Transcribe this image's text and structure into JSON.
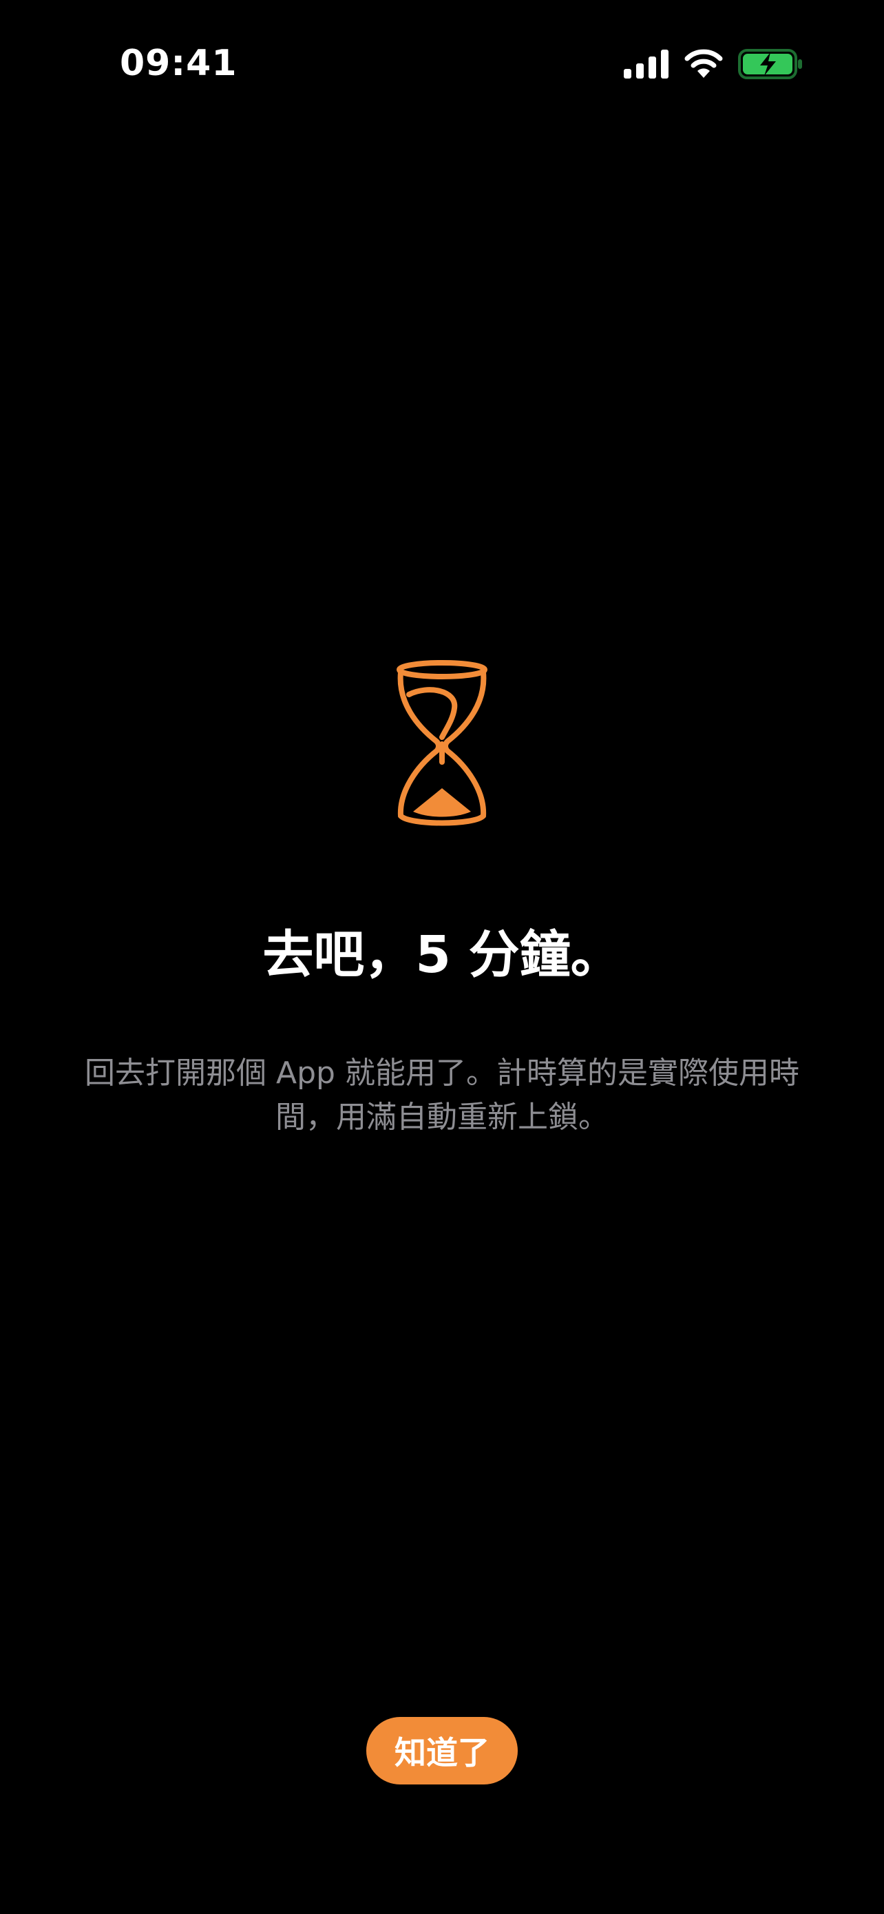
{
  "status_bar": {
    "time": "09:41",
    "icons": [
      "signal-icon",
      "wifi-icon",
      "battery-charging-icon"
    ],
    "battery_color": "#34c759"
  },
  "main": {
    "icon": "hourglass-icon",
    "icon_color": "#f28c38",
    "title": "去吧，5 分鐘。",
    "description": "回去打開那個 App 就能用了。計時算的是實際使用時間，用滿自動重新上鎖。"
  },
  "footer": {
    "ok_label": "知道了",
    "button_color": "#f28c38"
  }
}
